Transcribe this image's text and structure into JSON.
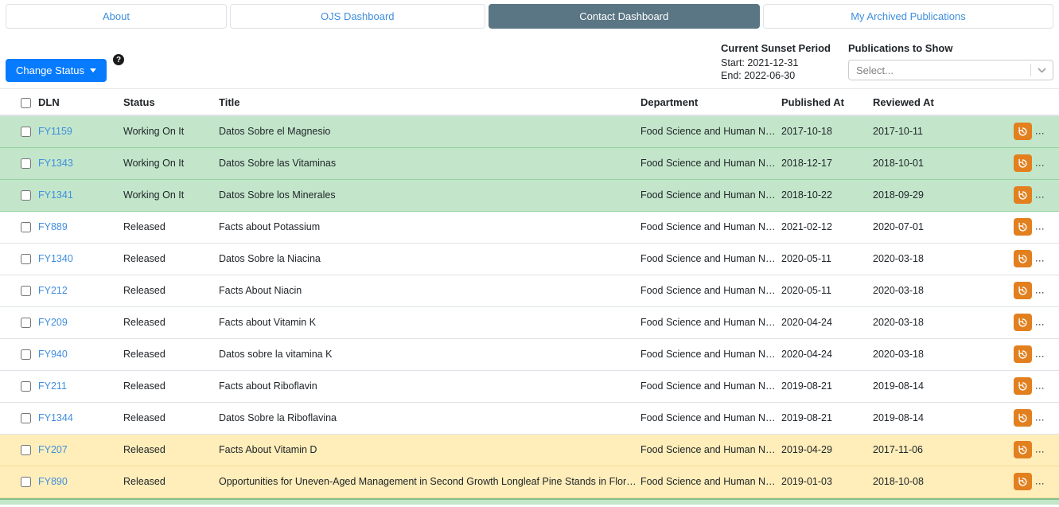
{
  "tabs": [
    {
      "label": "About",
      "active": false
    },
    {
      "label": "OJS Dashboard",
      "active": false
    },
    {
      "label": "Contact Dashboard",
      "active": true
    },
    {
      "label": "My Archived Publications",
      "active": false
    }
  ],
  "toolbar": {
    "change_status_label": "Change Status",
    "help_glyph": "?"
  },
  "sunset": {
    "title": "Current Sunset Period",
    "start": "Start: 2021-12-31",
    "end": "End: 2022-06-30"
  },
  "publications_filter": {
    "label": "Publications to Show",
    "placeholder": "Select..."
  },
  "table": {
    "headers": [
      "DLN",
      "Status",
      "Title",
      "Department",
      "Published At",
      "Reviewed At"
    ],
    "rows": [
      {
        "dln": "FY1159",
        "status": "Working On It",
        "title": "Datos Sobre el Magnesio",
        "department": "Food Science and Human Nutrit...",
        "published_at": "2017-10-18",
        "reviewed_at": "2017-10-11",
        "highlight": "green"
      },
      {
        "dln": "FY1343",
        "status": "Working On It",
        "title": "Datos Sobre las Vitaminas",
        "department": "Food Science and Human Nutrit...",
        "published_at": "2018-12-17",
        "reviewed_at": "2018-10-01",
        "highlight": "green"
      },
      {
        "dln": "FY1341",
        "status": "Working On It",
        "title": "Datos Sobre los Minerales",
        "department": "Food Science and Human Nutrit...",
        "published_at": "2018-10-22",
        "reviewed_at": "2018-09-29",
        "highlight": "green"
      },
      {
        "dln": "FY889",
        "status": "Released",
        "title": "Facts about Potassium",
        "department": "Food Science and Human Nutrit...",
        "published_at": "2021-02-12",
        "reviewed_at": "2020-07-01",
        "highlight": "none"
      },
      {
        "dln": "FY1340",
        "status": "Released",
        "title": "Datos Sobre la Niacina",
        "department": "Food Science and Human Nutrit...",
        "published_at": "2020-05-11",
        "reviewed_at": "2020-03-18",
        "highlight": "none"
      },
      {
        "dln": "FY212",
        "status": "Released",
        "title": "Facts About Niacin",
        "department": "Food Science and Human Nutrit...",
        "published_at": "2020-05-11",
        "reviewed_at": "2020-03-18",
        "highlight": "none"
      },
      {
        "dln": "FY209",
        "status": "Released",
        "title": "Facts about Vitamin K",
        "department": "Food Science and Human Nutrit...",
        "published_at": "2020-04-24",
        "reviewed_at": "2020-03-18",
        "highlight": "none"
      },
      {
        "dln": "FY940",
        "status": "Released",
        "title": "Datos sobre la vitamina K",
        "department": "Food Science and Human Nutrit...",
        "published_at": "2020-04-24",
        "reviewed_at": "2020-03-18",
        "highlight": "none"
      },
      {
        "dln": "FY211",
        "status": "Released",
        "title": "Facts about Riboflavin",
        "department": "Food Science and Human Nutrit...",
        "published_at": "2019-08-21",
        "reviewed_at": "2019-08-14",
        "highlight": "none"
      },
      {
        "dln": "FY1344",
        "status": "Released",
        "title": "Datos Sobre la Riboflavina",
        "department": "Food Science and Human Nutrit...",
        "published_at": "2019-08-21",
        "reviewed_at": "2019-08-14",
        "highlight": "none"
      },
      {
        "dln": "FY207",
        "status": "Released",
        "title": "Facts About Vitamin D",
        "department": "Food Science and Human Nutrit...",
        "published_at": "2019-04-29",
        "reviewed_at": "2017-11-06",
        "highlight": "yellow"
      },
      {
        "dln": "FY890",
        "status": "Released",
        "title": "Opportunities for Uneven-Aged Management in Second Growth Longleaf Pine Stands in Florida",
        "department": "Food Science and Human Nutrit...",
        "published_at": "2019-01-03",
        "reviewed_at": "2018-10-08",
        "highlight": "yellow"
      }
    ]
  },
  "colors": {
    "primary_blue": "#067bfe",
    "link_blue": "#3f8ede",
    "active_tab": "#5a7684",
    "row_green": "#c3e6cb",
    "row_yellow": "#ffeeba",
    "action_orange": "#e2801f"
  }
}
